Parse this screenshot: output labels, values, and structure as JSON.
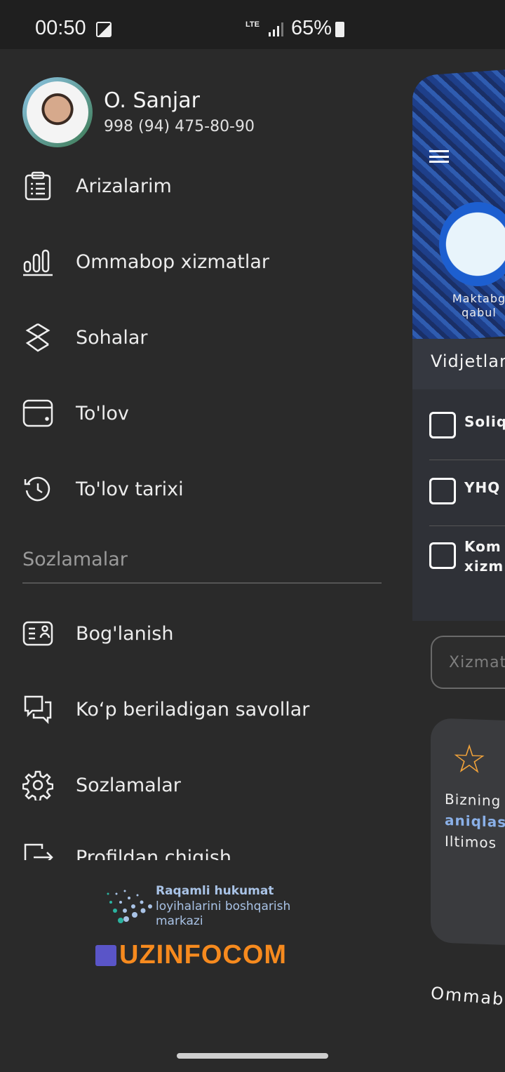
{
  "status_bar": {
    "time": "00:50",
    "network": "LTE",
    "battery": "65%"
  },
  "profile": {
    "name": "O. Sanjar",
    "phone": "998 (94) 475-80-90"
  },
  "menu": [
    {
      "label": "Arizalarim",
      "icon": "clipboard-list-icon"
    },
    {
      "label": "Ommabop xizmatlar",
      "icon": "bar-chart-icon"
    },
    {
      "label": "Sohalar",
      "icon": "categories-icon"
    },
    {
      "label": "To'lov",
      "icon": "wallet-icon"
    },
    {
      "label": "To'lov tarixi",
      "icon": "history-icon"
    }
  ],
  "settings_section": {
    "title": "Sozlamalar",
    "items": [
      {
        "label": "Bog'lanish",
        "icon": "contact-icon"
      },
      {
        "label": "Ko‘p beriladigan savollar",
        "icon": "chat-icon"
      },
      {
        "label": "Sozlamalar",
        "icon": "gear-icon"
      },
      {
        "label": "Profildan chiqish",
        "icon": "logout-icon"
      }
    ]
  },
  "footer": {
    "org_bold": "Raqamli hukumat",
    "org_rest": "loyihalarini boshqarish markazi",
    "brand": "UZINFOCOM"
  },
  "background": {
    "service_label": "Maktabg qabul",
    "widgets_title": "Vidjetlar",
    "widgets": [
      "Soliq",
      "YHQ",
      "Kom xizm"
    ],
    "search_placeholder": "Xizmat",
    "card_lines": [
      "Bizning",
      "aniqlas",
      "Iltimos"
    ],
    "popular_title": "Ommab"
  }
}
